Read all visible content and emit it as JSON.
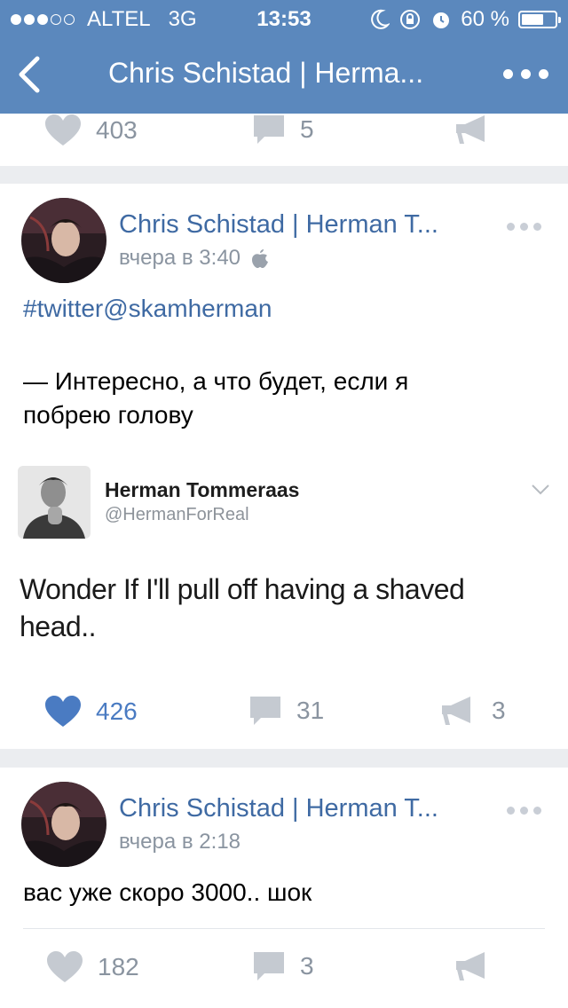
{
  "status_bar": {
    "carrier": "ALTEL",
    "network": "3G",
    "time": "13:53",
    "battery": "60 %",
    "signal_dots_filled": 3,
    "signal_dots_total": 5
  },
  "nav": {
    "title": "Chris Schistad | Herma..."
  },
  "top_card_actions": {
    "likes": "403",
    "comments": "5"
  },
  "posts": [
    {
      "author": "Chris Schistad | Herman T...",
      "time": "вчера в 3:40",
      "hashtag": "#twitter@skamherman",
      "text": "— Интересно, а что будет, если я побрею голову",
      "tweet": {
        "name": "Herman Tommeraas",
        "handle": "@HermanForReal",
        "text": "Wonder If I'll pull off having a shaved head.."
      },
      "likes": "426",
      "comments": "31",
      "reposts": "3"
    },
    {
      "author": "Chris Schistad | Herman T...",
      "time": "вчера в 2:18",
      "text": "вас уже скоро 3000.. шок",
      "likes": "182",
      "comments": "3"
    }
  ],
  "colors": {
    "header_bg": "#5b88bd",
    "link": "#3f6aa3",
    "liked": "#4a7bc2",
    "muted": "#8a94a0",
    "page_bg": "#ebedf0"
  }
}
